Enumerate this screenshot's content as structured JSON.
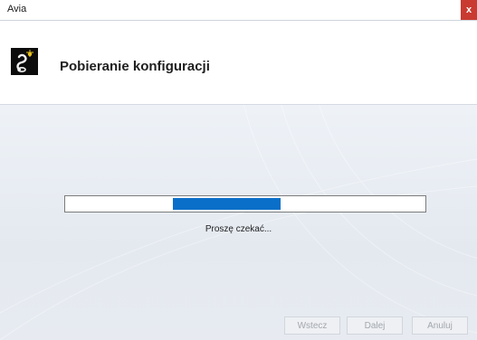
{
  "window": {
    "title": "Avia",
    "close_glyph": "x"
  },
  "header": {
    "title": "Pobieranie konfiguracji",
    "logo_icon": "avia-logo-icon"
  },
  "progress": {
    "fraction": 0.3,
    "status": "Proszę czekać..."
  },
  "buttons": {
    "back": "Wstecz",
    "next": "Dalej",
    "cancel": "Anuluj"
  },
  "colors": {
    "progress_fill": "#0a6fc8",
    "close_button": "#c93a30"
  }
}
